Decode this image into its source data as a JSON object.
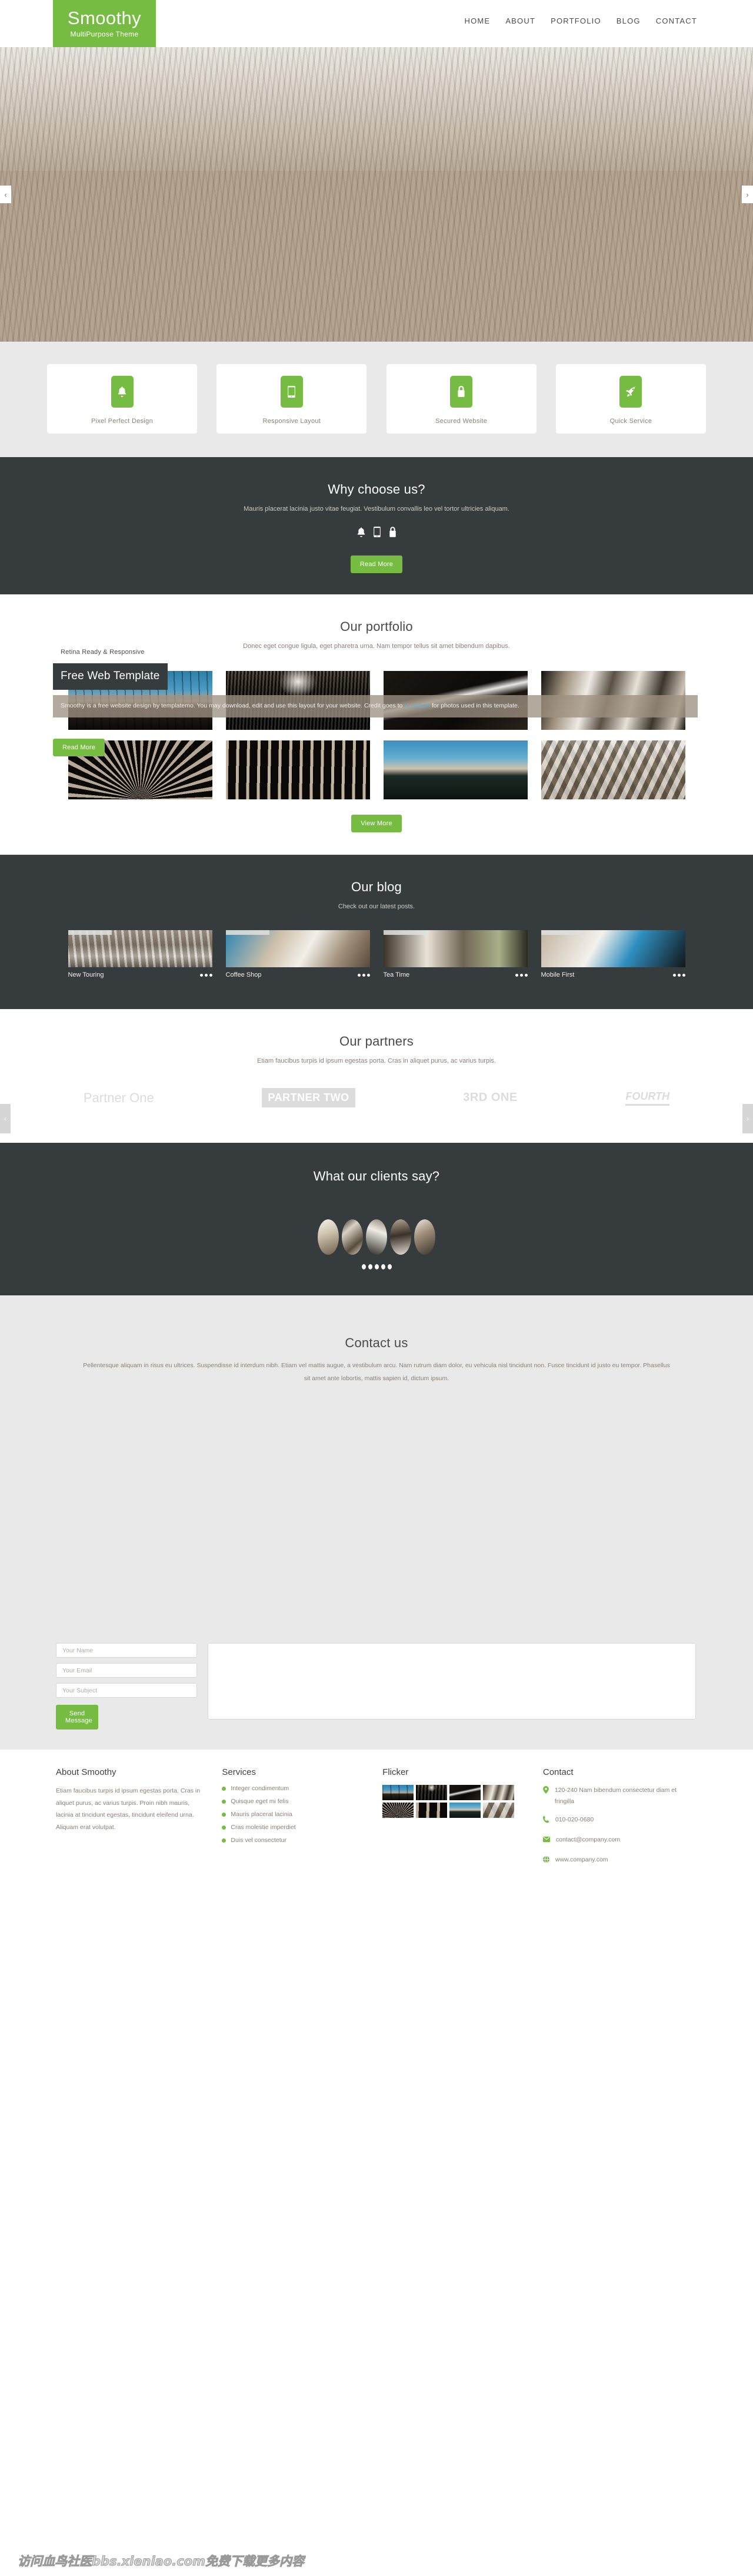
{
  "brand": {
    "name": "Smoothy",
    "tagline": "MultiPurpose Theme",
    "accent": "#76bc43",
    "dark": "#363b3e"
  },
  "nav": {
    "items": [
      {
        "label": "HOME"
      },
      {
        "label": "ABOUT"
      },
      {
        "label": "PORTFOLIO"
      },
      {
        "label": "BLOG"
      },
      {
        "label": "CONTACT"
      }
    ]
  },
  "hero": {
    "prev": "‹",
    "next": "›"
  },
  "features": {
    "items": [
      {
        "label": "Pixel Perfect Design",
        "icon": "bell-icon"
      },
      {
        "label": "Responsive Layout",
        "icon": "mobile-icon"
      },
      {
        "label": "Secured Website",
        "icon": "lock-icon"
      },
      {
        "label": "Quick Service",
        "icon": "rocket-icon"
      }
    ]
  },
  "why": {
    "title": "Why choose us?",
    "subtitle": "Mauris placerat lacinia justo vitae feugiat. Vestibulum convallis leo vel tortor ultricies aliquam.",
    "icons": [
      "bell-icon",
      "mobile-icon",
      "lock-icon"
    ],
    "button": "Read More"
  },
  "slider_caption": {
    "small": "Retina Ready & Responsive",
    "big": "Free Web Template",
    "credit_pre": "Smoothy is a free website design by templatemo. You may download, edit and use this layout for your website. Credit goes to ",
    "credit_link": "Unsplash",
    "credit_post": " for photos used in this template.",
    "button": "Read More"
  },
  "portfolio": {
    "title": "Our portfolio",
    "subtitle": "Donec eget congue ligula, eget pharetra urna. Nam tempor tellus sit amet bibendum dapibus.",
    "button": "View More",
    "items": [
      {
        "name": "blue-sky-reeds",
        "class": "th-sky"
      },
      {
        "name": "forest-light",
        "class": "th-tree"
      },
      {
        "name": "waterfall",
        "class": "th-fall"
      },
      {
        "name": "silk-waves",
        "class": "th-silk"
      },
      {
        "name": "ferris-wheel",
        "class": "th-fan"
      },
      {
        "name": "slat-facade",
        "class": "th-slat"
      },
      {
        "name": "lake-view",
        "class": "th-lake"
      },
      {
        "name": "cube-blocks",
        "class": "th-cube"
      }
    ]
  },
  "blog": {
    "title": "Our blog",
    "subtitle": "Check out our latest posts.",
    "posts": [
      {
        "title": "New Touring",
        "class": "bt-van"
      },
      {
        "title": "Coffee Shop",
        "class": "bt-cup"
      },
      {
        "title": "Tea Time",
        "class": "bt-tea"
      },
      {
        "title": "Mobile First",
        "class": "bt-phone"
      }
    ],
    "post_icons": [
      "calendar-icon",
      "user-icon",
      "tag-icon",
      "comment-icon"
    ]
  },
  "partners": {
    "title": "Our partners",
    "subtitle": "Etiam faucibus turpis id ipsum egestas porta. Cras in aliquet purus, ac varius turpis.",
    "prev": "‹",
    "next": "›",
    "logos": [
      {
        "label": "Partner One"
      },
      {
        "label": "PARTNER TWO"
      },
      {
        "label": "3RD ONE"
      },
      {
        "label": "FOURTH"
      }
    ]
  },
  "testimonials": {
    "title": "What our clients say?",
    "avatars": [
      "client-1",
      "client-2",
      "client-3",
      "client-4",
      "client-5"
    ],
    "dot_count": 5
  },
  "contact": {
    "title": "Contact us",
    "subtitle": "Pellentesque aliquam in risus eu ultrices. Suspendisse id interdum nibh. Etiam vel mattis augue, a vestibulum arcu. Nam rutrum diam dolor, eu vehicula nisl tincidunt non. Fusce tincidunt id justo eu tempor. Phasellus sit amet ante lobortis, mattis sapien id, dictum ipsum.",
    "form": {
      "name_placeholder": "Your Name",
      "name_value": "",
      "email_placeholder": "Your Email",
      "email_value": "",
      "subject_placeholder": "Your Subject",
      "subject_value": "",
      "message_placeholder": "",
      "message_value": "",
      "submit": "Send Message"
    }
  },
  "footer": {
    "about": {
      "heading": "About Smoothy",
      "text": "Etiam faucibus turpis id ipsum egestas porta. Cras in aliquet purus, ac varius turpis. Proin nibh mauris, lacinia at tincidunt egestas, tincidunt eleifend urna. Aliquam erat volutpat."
    },
    "services": {
      "heading": "Services",
      "items": [
        "Integer condimentum",
        "Quisque eget mi felis",
        "Mauris placerat lacinia",
        "Cras molestie imperdiet",
        "Duis vel consectetur"
      ]
    },
    "flicker": {
      "heading": "Flicker",
      "thumbs": [
        "th-sky",
        "th-tree",
        "th-fall",
        "th-silk",
        "th-fan",
        "th-slat",
        "th-lake",
        "th-cube"
      ]
    },
    "contact": {
      "heading": "Contact",
      "address": "120-240 Nam bibendum consectetur diam et fringilla",
      "phone": "010-020-0680",
      "email": "contact@company.com",
      "website": "www.company.com"
    }
  },
  "watermark": {
    "text": "访问血鸟社医bbs.xieniao.com免费下载更多内容"
  }
}
